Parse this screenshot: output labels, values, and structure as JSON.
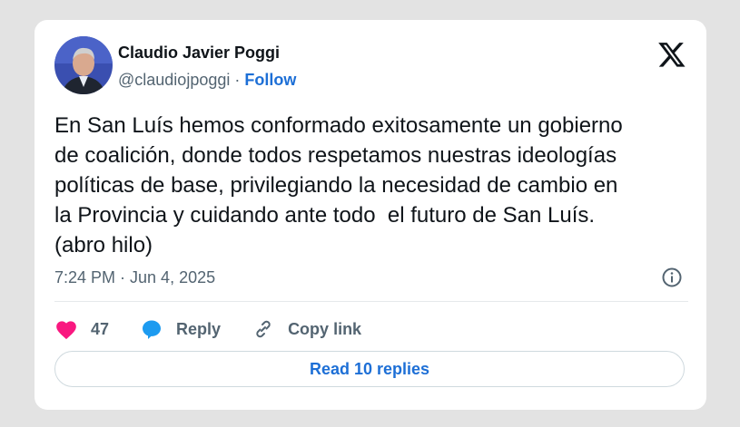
{
  "author": {
    "name": "Claudio Javier Poggi",
    "handle": "@claudiojpoggi",
    "separator": "·",
    "follow_label": "Follow"
  },
  "brand_icon": "x-logo-icon",
  "tweet": {
    "text": "En San Luís hemos conformado exitosamente un gobierno\nde coalición, donde todos respetamos nuestras ideologías\npolíticas de base, privilegiando la necesidad de cambio en\nla Provincia y cuidando ante todo  el futuro de San Luís.\n(abro hilo)",
    "timestamp": "7:24 PM · Jun 4, 2025"
  },
  "actions": {
    "like_count": "47",
    "reply_label": "Reply",
    "copy_link_label": "Copy link"
  },
  "read_replies_label": "Read 10 replies",
  "colors": {
    "accent": "#1d6fd6",
    "like": "#f91880",
    "muted": "#536471",
    "text": "#0f1419"
  }
}
